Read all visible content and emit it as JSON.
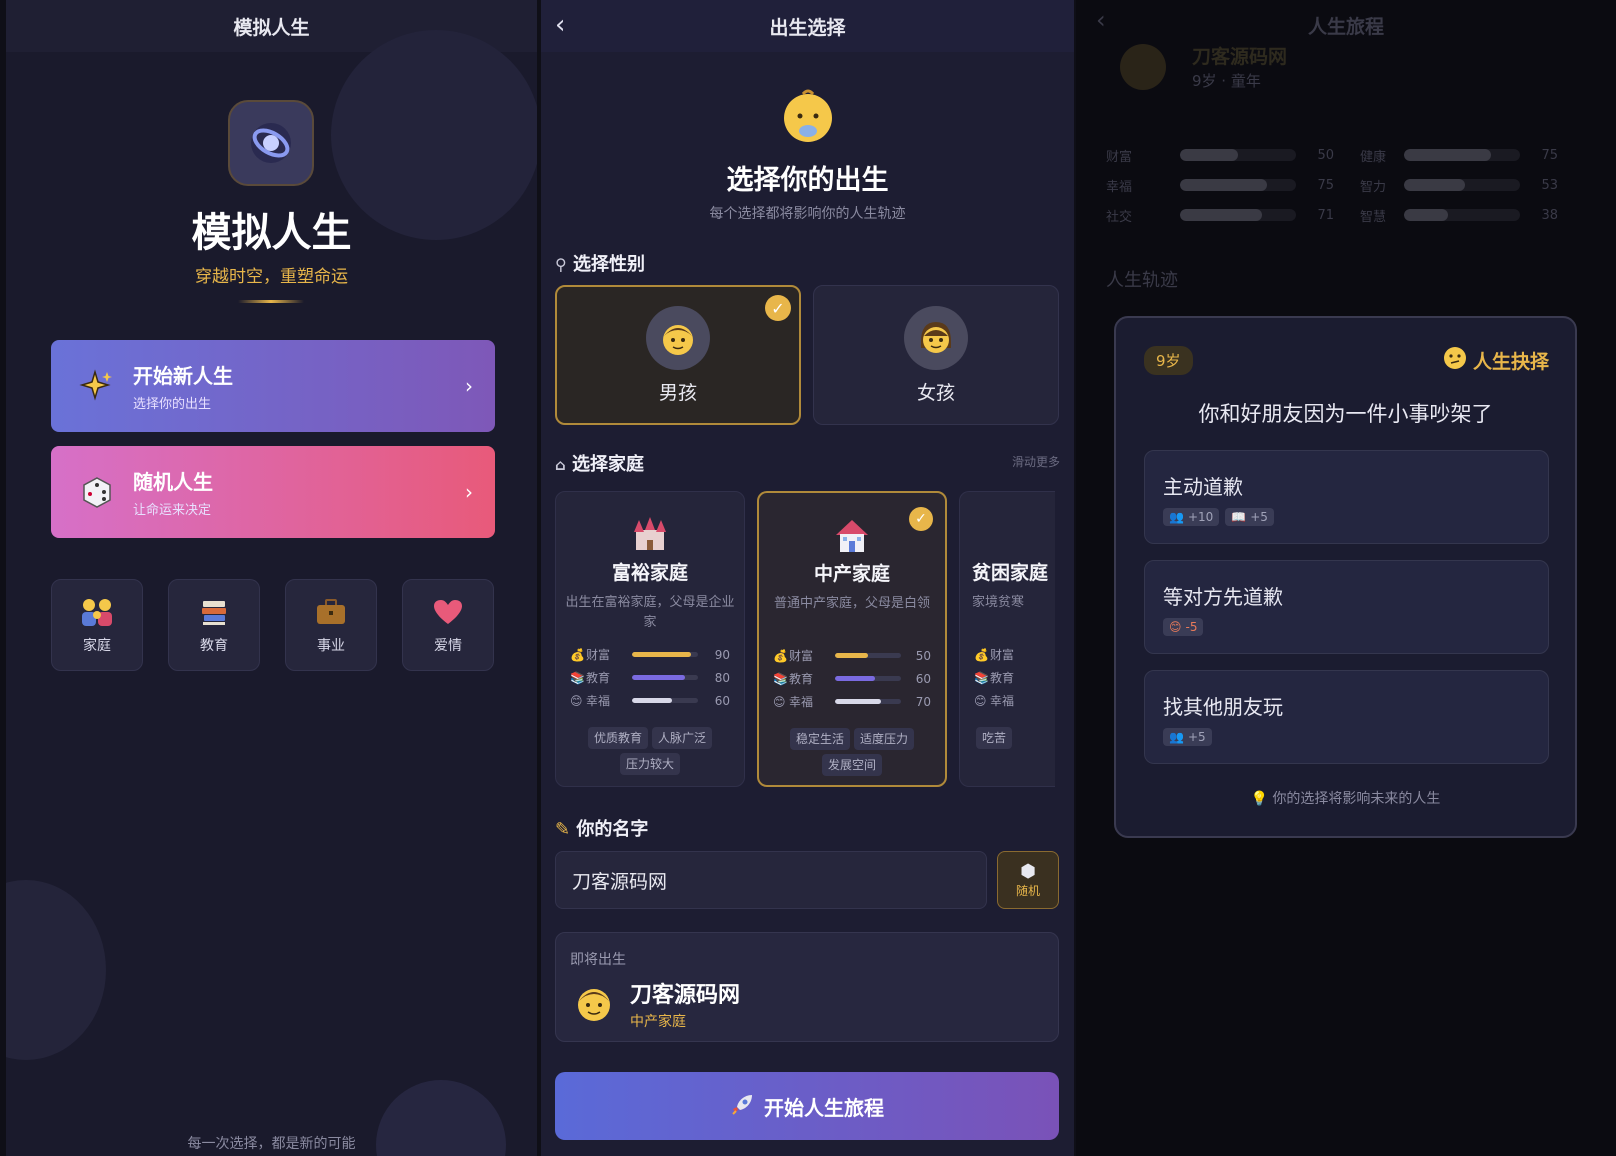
{
  "screen1": {
    "title": "模拟人生",
    "app_name": "模拟人生",
    "subtitle": "穿越时空，重塑命运",
    "btn_new": {
      "title": "开始新人生",
      "sub": "选择你的出生"
    },
    "btn_random": {
      "title": "随机人生",
      "sub": "让命运来决定"
    },
    "categories": [
      "家庭",
      "教育",
      "事业",
      "爱情"
    ],
    "footer": "每一次选择，都是新的可能"
  },
  "screen2": {
    "title": "出生选择",
    "heading": "选择你的出生",
    "subheading": "每个选择都将影响你的人生轨迹",
    "gender_section": "选择性别",
    "genders": [
      "男孩",
      "女孩"
    ],
    "family_section": "选择家庭",
    "more_hint": "滑动更多",
    "families": [
      {
        "name": "富裕家庭",
        "desc": "出生在富裕家庭，父母是企业家",
        "stats": [
          {
            "label": "财富",
            "value": 90
          },
          {
            "label": "教育",
            "value": 80
          },
          {
            "label": "幸福",
            "value": 60
          }
        ],
        "tags": [
          "优质教育",
          "人脉广泛",
          "压力较大"
        ]
      },
      {
        "name": "中产家庭",
        "desc": "普通中产家庭，父母是白领",
        "stats": [
          {
            "label": "财富",
            "value": 50
          },
          {
            "label": "教育",
            "value": 60
          },
          {
            "label": "幸福",
            "value": 70
          }
        ],
        "tags": [
          "稳定生活",
          "适度压力",
          "发展空间"
        ]
      },
      {
        "name": "贫困家庭",
        "desc": "家境贫寒",
        "stats": [
          {
            "label": "财富"
          },
          {
            "label": "教育"
          },
          {
            "label": "幸福"
          }
        ],
        "tags": [
          "吃苦"
        ]
      }
    ],
    "name_section": "你的名字",
    "name_value": "刀客源码网",
    "dice_label": "随机",
    "preview_label": "即将出生",
    "preview_name": "刀客源码网",
    "preview_family": "中产家庭",
    "start_button": "开始人生旅程"
  },
  "screen3": {
    "title": "人生旅程",
    "player_name": "刀客源码网",
    "player_meta": "9岁 · 童年",
    "stats": [
      {
        "label": "财富",
        "value": 50
      },
      {
        "label": "健康",
        "value": 75
      },
      {
        "label": "幸福",
        "value": 75
      },
      {
        "label": "智力",
        "value": 53
      },
      {
        "label": "社交",
        "value": 71
      },
      {
        "label": "智慧",
        "value": 38
      }
    ],
    "track_title": "人生轨迹",
    "modal": {
      "age": "9岁",
      "tag": "人生抉择",
      "question": "你和好朋友因为一件小事吵架了",
      "options": [
        {
          "text": "主动道歉",
          "badges": [
            "+10",
            "+5"
          ]
        },
        {
          "text": "等对方先道歉",
          "badges": [
            "-5"
          ]
        },
        {
          "text": "找其他朋友玩",
          "badges": [
            "+5"
          ]
        }
      ],
      "footer": "你的选择将影响未来的人生"
    }
  },
  "colors": {
    "accent_gold": "#e8b64a",
    "purple": "#6a6ad8",
    "pink": "#e05a8a"
  }
}
